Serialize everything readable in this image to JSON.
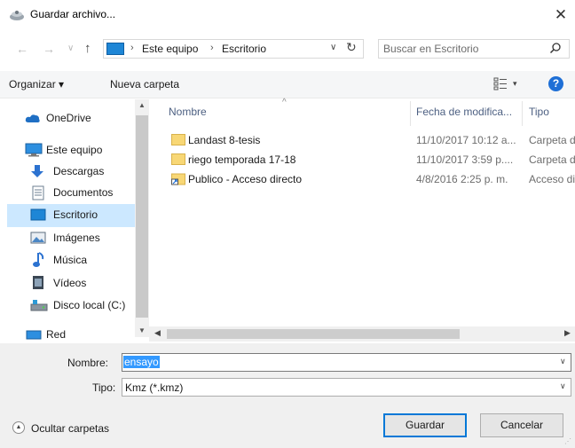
{
  "window": {
    "title": "Guardar archivo...",
    "close_glyph": "✕"
  },
  "nav": {
    "back": "←",
    "forward": "→",
    "recent": "∨",
    "up": "↑"
  },
  "address": {
    "crumbs": [
      "Este equipo",
      "Escritorio"
    ],
    "separator": "›",
    "dropdown": "∨",
    "refresh": "↻"
  },
  "search": {
    "placeholder": "Buscar en Escritorio"
  },
  "toolbar": {
    "organize": "Organizar ▾",
    "new_folder": "Nueva carpeta",
    "view_drop": "▾",
    "help": "?"
  },
  "sidebar": {
    "items": [
      {
        "label": "OneDrive",
        "icon": "cloud-icon"
      },
      {
        "label": "Este equipo",
        "icon": "computer-icon"
      },
      {
        "label": "Descargas",
        "icon": "download-icon"
      },
      {
        "label": "Documentos",
        "icon": "document-icon"
      },
      {
        "label": "Escritorio",
        "icon": "desktop-icon",
        "selected": true
      },
      {
        "label": "Imágenes",
        "icon": "pictures-icon"
      },
      {
        "label": "Música",
        "icon": "music-icon"
      },
      {
        "label": "Vídeos",
        "icon": "video-icon"
      },
      {
        "label": "Disco local (C:)",
        "icon": "drive-icon"
      },
      {
        "label": "Red",
        "icon": "network-icon"
      }
    ],
    "scroll_up": "▲",
    "scroll_down": "▼"
  },
  "list": {
    "columns": {
      "name": "Nombre",
      "date": "Fecha de modifica...",
      "type": "Tipo"
    },
    "sort_caret": "^",
    "rows": [
      {
        "name": "Landast 8-tesis",
        "date": "11/10/2017 10:12 a...",
        "type": "Carpeta d",
        "icon": "folder-icon"
      },
      {
        "name": "riego temporada 17-18",
        "date": "11/10/2017 3:59 p....",
        "type": "Carpeta d",
        "icon": "folder-icon"
      },
      {
        "name": "Publico - Acceso directo",
        "date": "4/8/2016 2:25 p. m.",
        "type": "Acceso di",
        "icon": "shortcut-icon"
      }
    ],
    "scroll_left": "◀",
    "scroll_right": "▶"
  },
  "form": {
    "name_label": "Nombre:",
    "name_value": "ensayo",
    "type_label": "Tipo:",
    "type_value": "Kmz (*.kmz)",
    "drop": "∨"
  },
  "footer": {
    "hide_folders": "Ocultar carpetas",
    "hide_glyph": "▲",
    "save": "Guardar",
    "cancel": "Cancelar",
    "grip": "⋰"
  },
  "colors": {
    "accent": "#0078d7",
    "selection": "#cce8ff",
    "text_selection": "#3399ff",
    "folder": "#f8d775"
  }
}
